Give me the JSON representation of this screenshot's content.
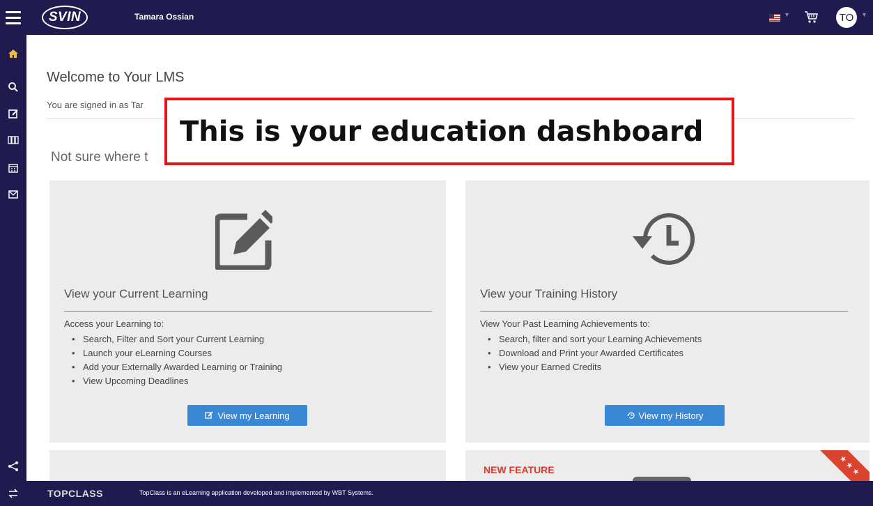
{
  "header": {
    "logo_text": "SVIN",
    "user_name": "Tamara Ossian",
    "avatar_initials": "TO",
    "icons": [
      "menu-icon",
      "flag-us-icon",
      "cart-icon",
      "chevron-down-icon"
    ]
  },
  "sidebar": {
    "items": [
      {
        "name": "home",
        "icon": "home-icon"
      },
      {
        "name": "search",
        "icon": "search-icon"
      },
      {
        "name": "edit",
        "icon": "edit-icon"
      },
      {
        "name": "catalog",
        "icon": "library-icon"
      },
      {
        "name": "calendar",
        "icon": "calendar-icon"
      },
      {
        "name": "messages",
        "icon": "envelope-icon"
      }
    ],
    "bottom_items": [
      {
        "name": "share",
        "icon": "share-icon"
      },
      {
        "name": "switch",
        "icon": "switch-icon"
      }
    ]
  },
  "main": {
    "welcome_title": "Welcome to Your LMS",
    "signed_in_text": "You are signed in as Tar",
    "not_sure_text": "Not sure where t",
    "cards": [
      {
        "title": "View your Current Learning",
        "intro": "Access your Learning to:",
        "bullets": [
          "Search, Filter and Sort your Current Learning",
          "Launch your eLearning Courses",
          "Add your Externally Awarded Learning or Training",
          "View Upcoming Deadlines"
        ],
        "button_label": "View my Learning",
        "icon": "edit-icon"
      },
      {
        "title": "View your Training History",
        "intro": "View Your Past Learning Achievements to:",
        "bullets": [
          "Search, filter and sort your Learning Achievements",
          "Download and Print your Awarded Certificates",
          "View your Earned Credits"
        ],
        "button_label": "View my History",
        "icon": "history-icon"
      }
    ],
    "new_feature_label": "NEW FEATURE"
  },
  "overlay": {
    "text": "This is your education dashboard",
    "border_color": "#e8141b"
  },
  "footer": {
    "brand": "TOPCLASS",
    "text": "TopClass is an eLearning application developed and implemented by WBT Systems."
  },
  "colors": {
    "nav_bg": "#1f1b4e",
    "button_blue": "#3a87d6",
    "card_bg": "#ececec",
    "accent_red": "#d83a2d"
  }
}
